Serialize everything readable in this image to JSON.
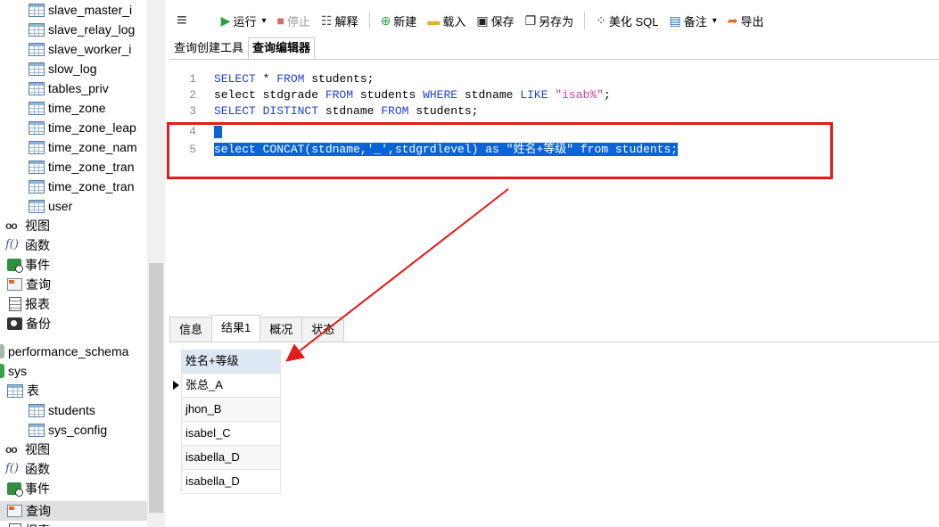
{
  "sidebar": {
    "items": [
      {
        "label": "slave_master_i",
        "icon": "table-icon"
      },
      {
        "label": "slave_relay_log",
        "icon": "table-icon"
      },
      {
        "label": "slave_worker_i",
        "icon": "table-icon"
      },
      {
        "label": "slow_log",
        "icon": "table-icon"
      },
      {
        "label": "tables_priv",
        "icon": "table-icon"
      },
      {
        "label": "time_zone",
        "icon": "table-icon"
      },
      {
        "label": "time_zone_leap",
        "icon": "table-icon"
      },
      {
        "label": "time_zone_nam",
        "icon": "table-icon"
      },
      {
        "label": "time_zone_tran",
        "icon": "table-icon"
      },
      {
        "label": "time_zone_tran",
        "icon": "table-icon"
      },
      {
        "label": "user",
        "icon": "table-icon"
      },
      {
        "label": "视图",
        "icon": "view-icon"
      },
      {
        "label": "函数",
        "icon": "function-icon"
      },
      {
        "label": "事件",
        "icon": "event-icon"
      },
      {
        "label": "查询",
        "icon": "query-icon"
      },
      {
        "label": "报表",
        "icon": "report-icon"
      },
      {
        "label": "备份",
        "icon": "backup-icon"
      },
      {
        "label": "performance_schema",
        "icon": "database-icon"
      },
      {
        "label": "sys",
        "icon": "database-icon"
      },
      {
        "label": "表",
        "icon": "table-icon"
      },
      {
        "label": "students",
        "icon": "table-icon"
      },
      {
        "label": "sys_config",
        "icon": "table-icon"
      },
      {
        "label": "视图",
        "icon": "view-icon"
      },
      {
        "label": "函数",
        "icon": "function-icon"
      },
      {
        "label": "事件",
        "icon": "event-icon"
      },
      {
        "label": "查询",
        "icon": "query-icon"
      },
      {
        "label": "报表",
        "icon": "report-icon"
      }
    ]
  },
  "toolbar": {
    "run_label": "运行",
    "stop_label": "停止",
    "explain_label": "解释",
    "new_label": "新建",
    "load_label": "载入",
    "save_label": "保存",
    "save_as_label": "另存为",
    "beautify_label": "美化 SQL",
    "comment_label": "备注",
    "export_label": "导出"
  },
  "editor_tabs": [
    "查询创建工具",
    "查询编辑器"
  ],
  "editor": {
    "line_numbers": [
      "1",
      "2",
      "3",
      "4",
      "5"
    ],
    "line1": {
      "kw1": "SELECT",
      "rest1": " * ",
      "kw2": "FROM",
      "rest2": " students;"
    },
    "line2": {
      "t1": "select stdgrade ",
      "kw1": "FROM",
      "t2": " students ",
      "kw2": "WHERE",
      "t3": " stdname ",
      "kw3": "LIKE",
      "t4": " ",
      "str": "\"isab%\"",
      "t5": ";"
    },
    "line3": {
      "kw1": "SELECT DISTINCT",
      "t1": " stdname ",
      "kw2": "FROM",
      "t2": " students;"
    },
    "line5": "select CONCAT(stdname,'_',stdgrdlevel) as \"姓名+等级\" from students;"
  },
  "result_tabs": [
    "信息",
    "结果1",
    "概况",
    "状态"
  ],
  "result": {
    "header": "姓名+等级",
    "rows": [
      "张总_A",
      "jhon_B",
      "isabel_C",
      "isabella_D",
      "isabella_D"
    ]
  },
  "colors": {
    "keyword": "#2442c4",
    "string": "#d23a9b",
    "selection": "#0a64d8",
    "annotation": "#e31b1b"
  }
}
